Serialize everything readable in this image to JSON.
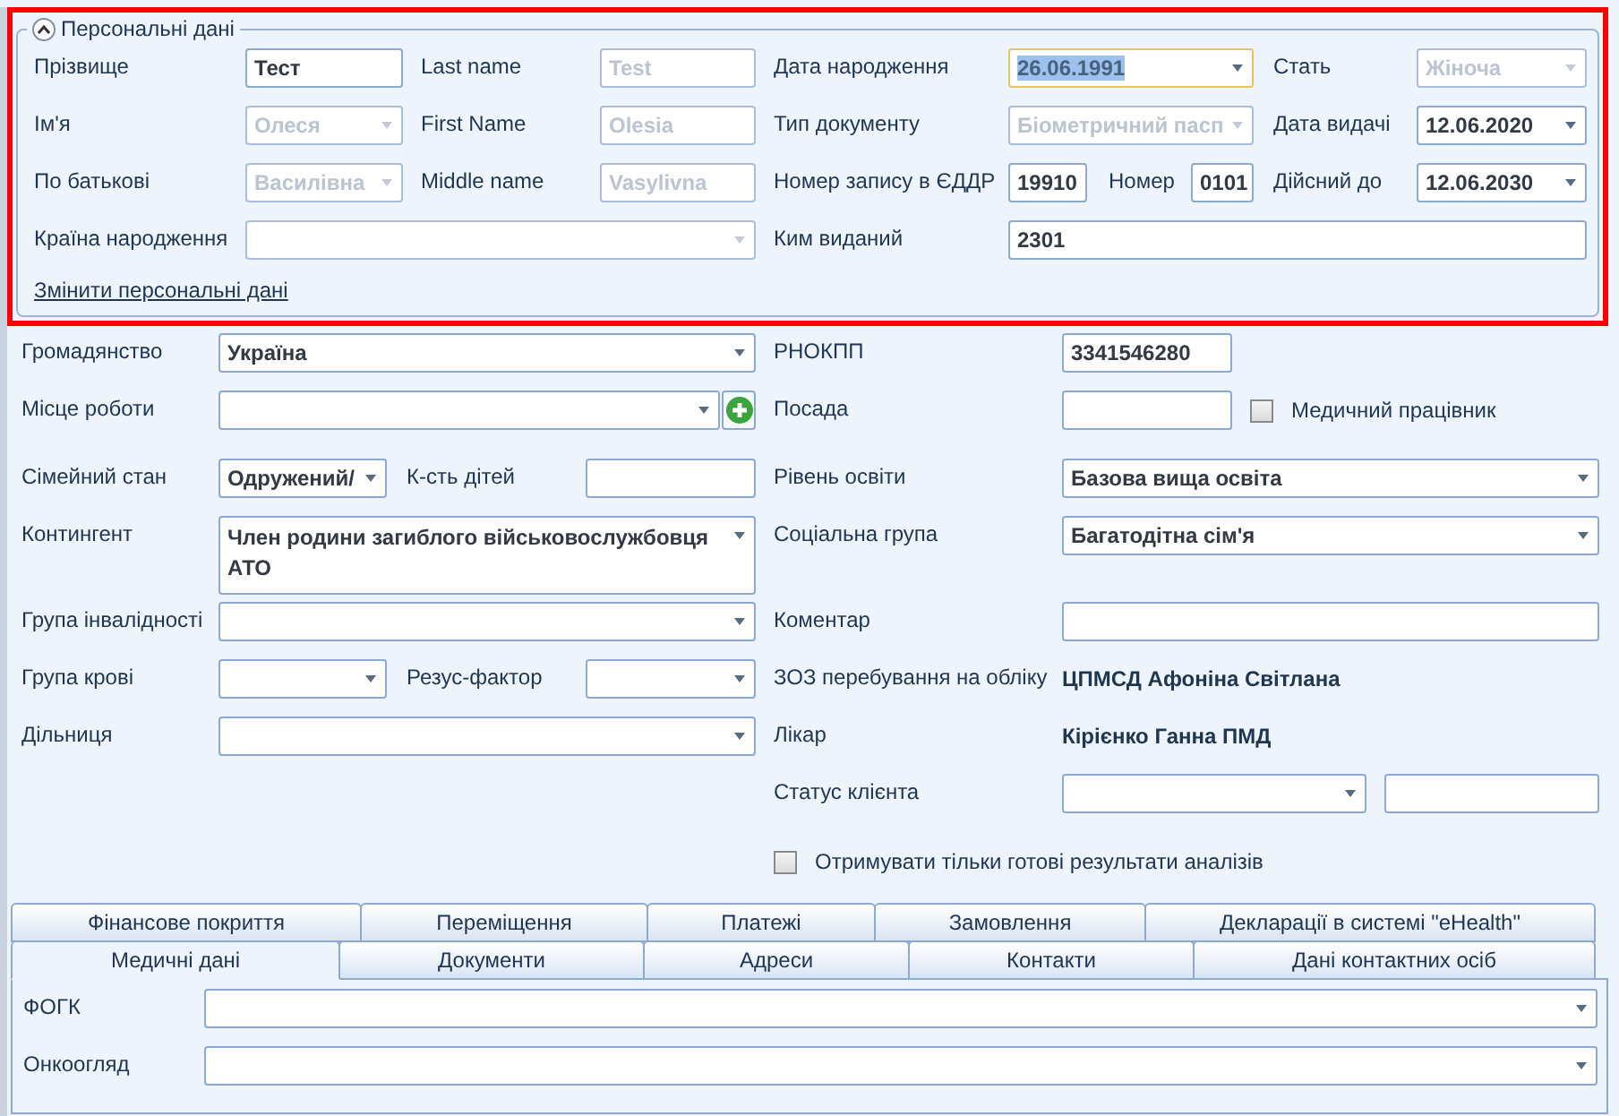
{
  "personal": {
    "title": "Персональні дані",
    "expanded": true,
    "fields": [
      {
        "label": "Прізвище",
        "kind": "text",
        "value": "Тест",
        "disabled": false
      },
      {
        "label": "Last name",
        "kind": "text",
        "value": "Test",
        "disabled": true
      },
      {
        "label": "Дата народження",
        "kind": "combo",
        "value": "26.06.1991",
        "disabled": false,
        "focused": true
      },
      {
        "label": "Стать",
        "kind": "combo",
        "value": "Жіноча",
        "disabled": true
      },
      {
        "label": "Ім'я",
        "kind": "combo",
        "value": "Олеся",
        "disabled": true
      },
      {
        "label": "First Name",
        "kind": "text",
        "value": "Olesia",
        "disabled": true
      },
      {
        "label": "Тип документу",
        "kind": "combo",
        "value": "Біометричний пасп",
        "disabled": true
      },
      {
        "label": "Дата видачі",
        "kind": "combo",
        "value": "12.06.2020",
        "disabled": false
      },
      {
        "label": "По батькові",
        "kind": "combo",
        "value": "Василівна",
        "disabled": true
      },
      {
        "label": "Middle name",
        "kind": "text",
        "value": "Vasylivna",
        "disabled": true
      },
      {
        "label": "Номер запису в ЄДДР",
        "kind": "text",
        "value": "19910",
        "disabled": false
      },
      {
        "label": "Номер",
        "kind": "text",
        "value": "0101",
        "disabled": false
      },
      {
        "label": "Дійсний до",
        "kind": "combo",
        "value": "12.06.2030",
        "disabled": false
      },
      {
        "label": "Країна народження",
        "kind": "combo",
        "disabled": true
      },
      {
        "label": "Ким виданий",
        "kind": "text",
        "value": "2301",
        "disabled": false
      }
    ],
    "link": "Змінити персональні дані"
  },
  "main": {
    "rows": [
      [
        {
          "kind": "label",
          "text": "Громадянство"
        },
        {
          "kind": "combo",
          "value": "Україна"
        },
        {
          "kind": "label",
          "text": "РНОКПП"
        },
        {
          "kind": "text",
          "value": "3341546280"
        }
      ],
      [
        {
          "kind": "label",
          "text": "Місце роботи"
        },
        {
          "kind": "combo_add"
        },
        {
          "kind": "label",
          "text": "Посада"
        },
        {
          "kind": "text"
        },
        {
          "kind": "checkbox",
          "text": "Медичний працівник",
          "checked": false
        }
      ],
      [
        {
          "kind": "label",
          "text": "Сімейний стан"
        },
        {
          "kind": "combo",
          "value": "Одружений/"
        },
        {
          "kind": "label",
          "text": "К-сть дітей"
        },
        {
          "kind": "text"
        },
        {
          "kind": "label",
          "text": "Рівень освіти"
        },
        {
          "kind": "combo",
          "value": "Базова вища освіта"
        }
      ],
      [
        {
          "kind": "label",
          "text": "Контингент"
        },
        {
          "kind": "combo",
          "value": "Член родини загиблого військовослужбовця АТО"
        },
        {
          "kind": "label",
          "text": "Соціальна група"
        },
        {
          "kind": "combo",
          "value": "Багатодітна сім'я"
        }
      ],
      [
        {
          "kind": "label",
          "text": "Група інвалідності"
        },
        {
          "kind": "combo"
        },
        {
          "kind": "label",
          "text": "Коментар"
        },
        {
          "kind": "text"
        }
      ],
      [
        {
          "kind": "label",
          "text": "Група крові"
        },
        {
          "kind": "combo"
        },
        {
          "kind": "label",
          "text": "Резус-фактор"
        },
        {
          "kind": "combo"
        },
        {
          "kind": "label",
          "text": "ЗОЗ перебування на обліку"
        },
        {
          "kind": "value",
          "text": "ЦПМСД Афоніна Світлана"
        }
      ],
      [
        {
          "kind": "label",
          "text": "Дільниця"
        },
        {
          "kind": "combo"
        },
        {
          "kind": "label",
          "text": "Лікар"
        },
        {
          "kind": "value",
          "text": "Кірієнко Ганна ПМД"
        }
      ],
      [
        {
          "kind": "label",
          "text": "Статус клієнта"
        },
        {
          "kind": "combo"
        },
        {
          "kind": "text"
        }
      ],
      [
        {
          "kind": "checkbox",
          "text": "Отримувати тільки готові результати аналізів",
          "checked": false
        }
      ]
    ]
  },
  "tab_rows": [
    [
      {
        "label": "Фінансове покриття",
        "selected": false
      },
      {
        "label": "Переміщення",
        "selected": false
      },
      {
        "label": "Платежі",
        "selected": false
      },
      {
        "label": "Замовлення",
        "selected": false
      },
      {
        "label": "Декларації в системі \"eHealth\"",
        "selected": false
      }
    ],
    [
      {
        "label": "Медичні дані",
        "selected": true
      },
      {
        "label": "Документи",
        "selected": false
      },
      {
        "label": "Адреси",
        "selected": false
      },
      {
        "label": "Контакти",
        "selected": false
      },
      {
        "label": "Дані контактних осіб",
        "selected": false
      }
    ]
  ],
  "tab_panel": {
    "fields": [
      {
        "label": "ФОГК",
        "kind": "combo"
      },
      {
        "label": "Онкоогляд",
        "kind": "combo"
      }
    ]
  }
}
